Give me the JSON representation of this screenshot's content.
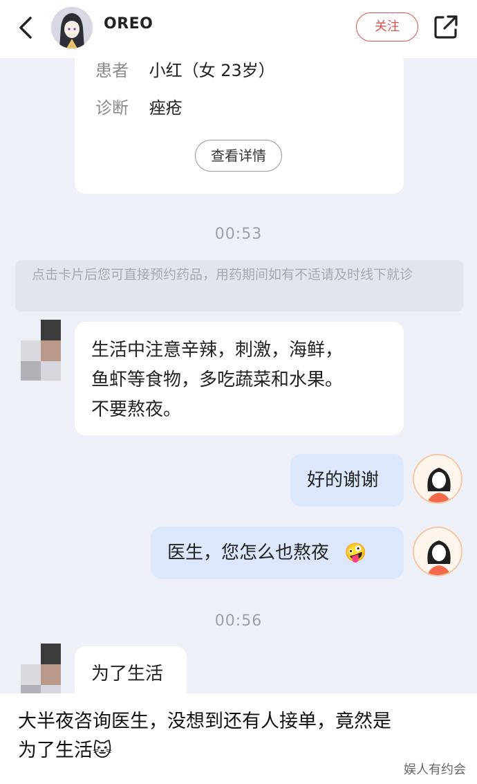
{
  "header": {
    "username": "OREO",
    "follow_label": "关注",
    "icons": {
      "back": "back-chevron-icon",
      "share": "share-icon"
    }
  },
  "card": {
    "patient_label": "患者",
    "patient_value": "小红（女 23岁）",
    "diagnosis_label": "诊断",
    "diagnosis_value": "痤疮",
    "details_button": "查看详情"
  },
  "timestamps": [
    "00:53",
    "00:56"
  ],
  "notice": "点击卡片后您可直接预约药品，用药期间如有不适请及时线下就诊",
  "messages": [
    {
      "from": "doctor",
      "lines": [
        "生活中注意辛辣，刺激，海鲜，",
        "鱼虾等食物，多吃蔬菜和水果。",
        "不要熬夜。"
      ]
    },
    {
      "from": "user",
      "text": "好的谢谢"
    },
    {
      "from": "user",
      "text": "医生，您怎么也熬夜",
      "emoji": "🤪"
    },
    {
      "from": "doctor",
      "text": "为了生活"
    }
  ],
  "caption": {
    "line1": "大半夜咨询医生，没想到还有人接单，竟然是",
    "line2": "为了生活",
    "emoji": "🐱"
  },
  "watermark": "娱人有约会",
  "colors": {
    "accent": "#e0504a",
    "chat_bg": "#eef0f7",
    "user_bubble": "#dce7fb"
  }
}
